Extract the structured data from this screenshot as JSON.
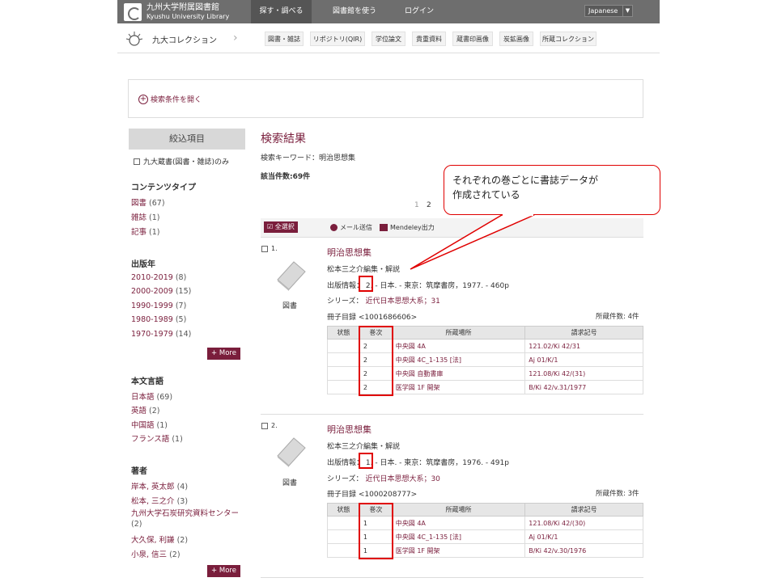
{
  "header": {
    "logo_line1": "九州大学附属図書館",
    "logo_line2": "Kyushu University Library",
    "nav": [
      "探す・調べる",
      "図書館を使う",
      "ログイン"
    ],
    "language": "Japanese"
  },
  "collection": {
    "label": "九大コレクション",
    "tabs": [
      "図書・雑誌",
      "リポジトリ(QIR)",
      "学位論文",
      "貴重資料",
      "蔵書印画像",
      "炭鉱画像",
      "所蔵コレクション"
    ]
  },
  "search_condition": {
    "label": "検索条件を開く"
  },
  "sidebar": {
    "head": "絞込項目",
    "kyudai_only": "九大蔵書(図書・雑誌)のみ",
    "sections": [
      {
        "title": "コンテンツタイプ",
        "items": [
          [
            "図書",
            "(67)"
          ],
          [
            "雑誌",
            "(1)"
          ],
          [
            "記事",
            "(1)"
          ]
        ]
      },
      {
        "title": "出版年",
        "items": [
          [
            "2010-2019",
            "(8)"
          ],
          [
            "2000-2009",
            "(15)"
          ],
          [
            "1990-1999",
            "(7)"
          ],
          [
            "1980-1989",
            "(5)"
          ],
          [
            "1970-1979",
            "(14)"
          ]
        ],
        "more": "+ More"
      },
      {
        "title": "本文言語",
        "items": [
          [
            "日本語",
            "(69)"
          ],
          [
            "英語",
            "(2)"
          ],
          [
            "中国語",
            "(1)"
          ],
          [
            "フランス語",
            "(1)"
          ]
        ]
      },
      {
        "title": "著者",
        "items": [
          [
            "岸本, 英太郎",
            "(4)"
          ],
          [
            "松本, 三之介",
            "(3)"
          ],
          [
            "九州大学石炭研究資料センター",
            "(2)"
          ],
          [
            "大久保, 利謙",
            "(2)"
          ],
          [
            "小泉, 信三",
            "(2)"
          ]
        ],
        "more": "+ More"
      }
    ]
  },
  "main": {
    "title": "検索結果",
    "keyword": "検索キーワード：明治思想集",
    "hits": "該当件数:69件",
    "pages": [
      "1",
      "2"
    ],
    "toolbar": {
      "select_all": "全選択",
      "mail": "メール送信",
      "mendeley": "Mendeley出力"
    },
    "records": [
      {
        "num": "1.",
        "type": "図書",
        "title": "明治思想集",
        "author": "松本三之介編集・解説",
        "pub_label": "出版情報：",
        "vol": "2",
        "pub_rest": ". - 日本. - 東京：筑摩書房，1977. - 460p",
        "series_label": "シリーズ：",
        "series": "近代日本思想大系；31",
        "catalog": "冊子目録 <1001686606>",
        "holdings_count": "所蔵件数: 4件",
        "holdings": [
          [
            "",
            "2",
            "中央図 4A",
            "121.02/Ki 42/31"
          ],
          [
            "",
            "2",
            "中央図 4C_1-135 [法]",
            "Aj 01/K/1"
          ],
          [
            "",
            "2",
            "中央図 自動書庫",
            "121.08/Ki 42/(31)"
          ],
          [
            "",
            "2",
            "医学図 1F 開架",
            "B/Ki 42/v.31/1977"
          ]
        ]
      },
      {
        "num": "2.",
        "type": "図書",
        "title": "明治思想集",
        "author": "松本三之介編集・解説",
        "pub_label": "出版情報：",
        "vol": "1",
        "pub_rest": ". - 日本. - 東京：筑摩書房，1976. - 491p",
        "series_label": "シリーズ：",
        "series": "近代日本思想大系；30",
        "catalog": "冊子目録 <1000208777>",
        "holdings_count": "所蔵件数: 3件",
        "holdings": [
          [
            "",
            "1",
            "中央図 4A",
            "121.08/Ki 42/(30)"
          ],
          [
            "",
            "1",
            "中央図 4C_1-135 [法]",
            "Aj 01/K/1"
          ],
          [
            "",
            "1",
            "医学図 1F 開架",
            "B/Ki 42/v.30/1976"
          ]
        ]
      }
    ],
    "table_headers": [
      "状態",
      "巻次",
      "所蔵場所",
      "請求記号"
    ]
  },
  "annotation": {
    "text_line1": "それぞれの巻ごとに書誌データが",
    "text_line2": "作成されている",
    "color": "#e00000"
  },
  "colors": {
    "accent": "#7a1e3c",
    "topbar": "#6e6e6e"
  }
}
